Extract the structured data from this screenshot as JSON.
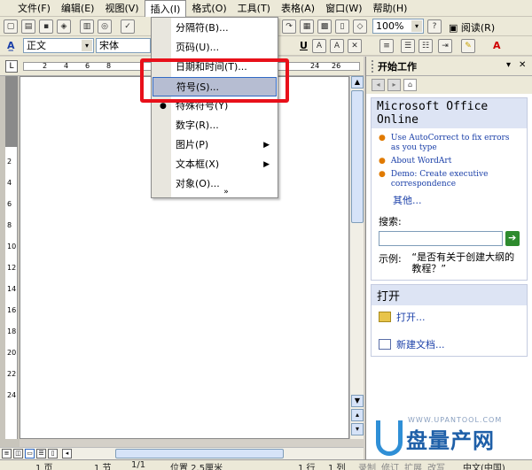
{
  "menubar": {
    "items": [
      "文件(F)",
      "编辑(E)",
      "视图(V)",
      "插入(I)",
      "格式(O)",
      "工具(T)",
      "表格(A)",
      "窗口(W)",
      "帮助(H)"
    ],
    "active": "插入(I)"
  },
  "toolbar1": {
    "zoom": "100%",
    "read_label": "阅读(R)"
  },
  "toolbar2": {
    "style_value": "正文",
    "font_value": "宋体",
    "bold": "B",
    "underline": "U",
    "font_color": "A"
  },
  "ruler": {
    "numbers": [
      "2",
      "4",
      "6",
      "8",
      "24",
      "26"
    ],
    "corner": "L",
    "vertical_numbers": [
      "2",
      "4",
      "6",
      "8",
      "10",
      "12",
      "14",
      "16",
      "18",
      "20",
      "22",
      "24"
    ]
  },
  "insert_menu": {
    "items": [
      {
        "label": "分隔符(B)..."
      },
      {
        "label": "页码(U)..."
      },
      {
        "label": "日期和时间(T)..."
      },
      {
        "label": "符号(S)...",
        "highlighted": true
      },
      {
        "label": "特殊符号(Y)"
      },
      {
        "label": "数字(R)..."
      },
      {
        "label": "图片(P)",
        "submenu": true
      },
      {
        "label": "文本框(X)",
        "submenu": true
      },
      {
        "label": "对象(O)..."
      }
    ],
    "expand_glyph": "»"
  },
  "task_pane": {
    "title": "开始工作",
    "office_title": "Microsoft Office Online",
    "links": [
      "Use AutoCorrect to fix errors as you type",
      "About WordArt",
      "Demo: Create executive correspondence"
    ],
    "more": "其他...",
    "search_label": "搜索:",
    "example_label": "示例:",
    "example_text": "“是否有关于创建大纲的教程？”",
    "open_title": "打开",
    "open_item": "打开...",
    "new_doc": "新建文档..."
  },
  "status": {
    "page": "1 页",
    "section": "1 节",
    "page_of": "1/1",
    "position": "位置 2.5厘米",
    "line": "1 行",
    "col": "1 列",
    "modes": [
      "录制",
      "修订",
      "扩展",
      "改写"
    ],
    "lang": "中文(中国)"
  },
  "watermark": {
    "cn": "盘量产网",
    "en": "WWW.UPANTOOL.COM"
  },
  "colors": {
    "highlight_box": "#e8101a",
    "menu_highlight": "#b6bdd2",
    "link": "#1a3fa8",
    "bullet": "#e07a00"
  }
}
